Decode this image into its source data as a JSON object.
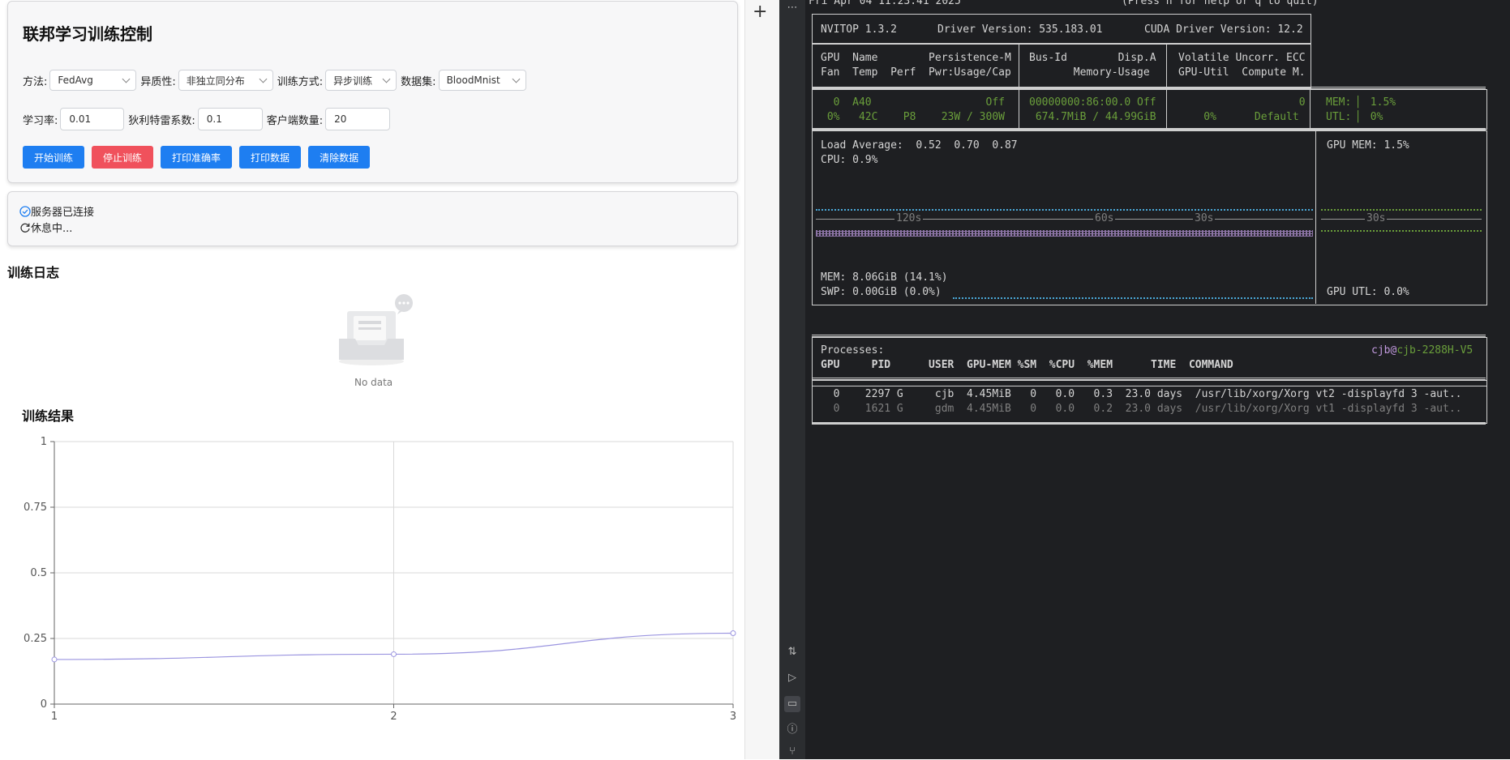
{
  "control": {
    "title": "联邦学习训练控制",
    "method_label": "方法:",
    "method_value": "FedAvg",
    "hetero_label": "异质性:",
    "hetero_value": "非独立同分布",
    "mode_label": "训练方式:",
    "mode_value": "异步训练",
    "dataset_label": "数据集:",
    "dataset_value": "BloodMnist",
    "lr_label": "学习率:",
    "lr_value": "0.01",
    "dirichlet_label": "狄利特雷系数:",
    "dirichlet_value": "0.1",
    "clients_label": "客户端数量:",
    "clients_value": "20",
    "buttons": {
      "start": "开始训练",
      "stop": "停止训练",
      "print_acc": "打印准确率",
      "print_data": "打印数据",
      "clear": "清除数据"
    }
  },
  "status": {
    "connected": "服务器已连接",
    "idle": "休息中..."
  },
  "log": {
    "title": "训练日志",
    "empty_text": "No data"
  },
  "results": {
    "title": "训练结果"
  },
  "chart_data": {
    "type": "line",
    "x": [
      1,
      2,
      3
    ],
    "series": [
      {
        "values": [
          0.17,
          0.19,
          0.27
        ],
        "color": "#9b95e0"
      }
    ],
    "xticks": [
      "1",
      "2",
      "3"
    ],
    "yticks": [
      "0",
      "0.25",
      "0.5",
      "0.75",
      "1"
    ],
    "ylim": [
      0,
      1
    ],
    "xlim": [
      1,
      3
    ],
    "grid": true
  },
  "terminal": {
    "top_left": "Fri Apr 04 11:23:41 2025",
    "top_right": "(Press h for help or q to quit)",
    "nvitop": "NVITOP 1.3.2",
    "driver": "Driver Version: 535.183.01",
    "cuda": "CUDA Driver Version: 12.2",
    "hdr1": "GPU  Name        Persistence-M",
    "hdr2": "Fan  Temp  Perf  Pwr:Usage/Cap",
    "hdr3": "Bus-Id        Disp.A",
    "hdr4": "       Memory-Usage",
    "hdr5": "Volatile Uncorr. ECC",
    "hdr6": "GPU-Util  Compute M.",
    "gpu_row1": "  0  A40                  Off",
    "gpu_row2": " 0%   42C    P8    23W / 300W",
    "bus_row1": "00000000:86:00.0 Off",
    "bus_row2": " 674.7MiB / 44.99GiB",
    "ecc_row1": "                   0",
    "ecc_row2": "    0%      Default",
    "mem_side": "MEM: ▏ 1.5%",
    "utl_side": "UTL: ▏ 0%",
    "load": "Load Average:  0.52  0.70  0.87",
    "cpu": "CPU: 0.9%",
    "gpu_mem": "GPU MEM: 1.5%",
    "t120": "120s",
    "t60": "60s",
    "t30": "30s",
    "t30b": "30s",
    "mem": "MEM: 8.06GiB (14.1%)",
    "swp": "SWP: 0.00GiB (0.0%)",
    "gpu_utl": "GPU UTL: 0.0%",
    "processes": "Processes:",
    "host_user": "cjb",
    "host_at": "@",
    "host_name": "cjb-2288H-V5",
    "proc_hdr": "GPU     PID      USER  GPU-MEM %SM  %CPU  %MEM      TIME  COMMAND",
    "proc1": "  0    2297 G     cjb  4.45MiB   0   0.0   0.3  23.0 days  /usr/lib/xorg/Xorg vt2 -displayfd 3 -aut..",
    "proc2": "  0    1621 G     gdm  4.45MiB   0   0.0   0.2  23.0 days  /usr/lib/xorg/Xorg vt1 -displayfd 3 -aut.."
  }
}
